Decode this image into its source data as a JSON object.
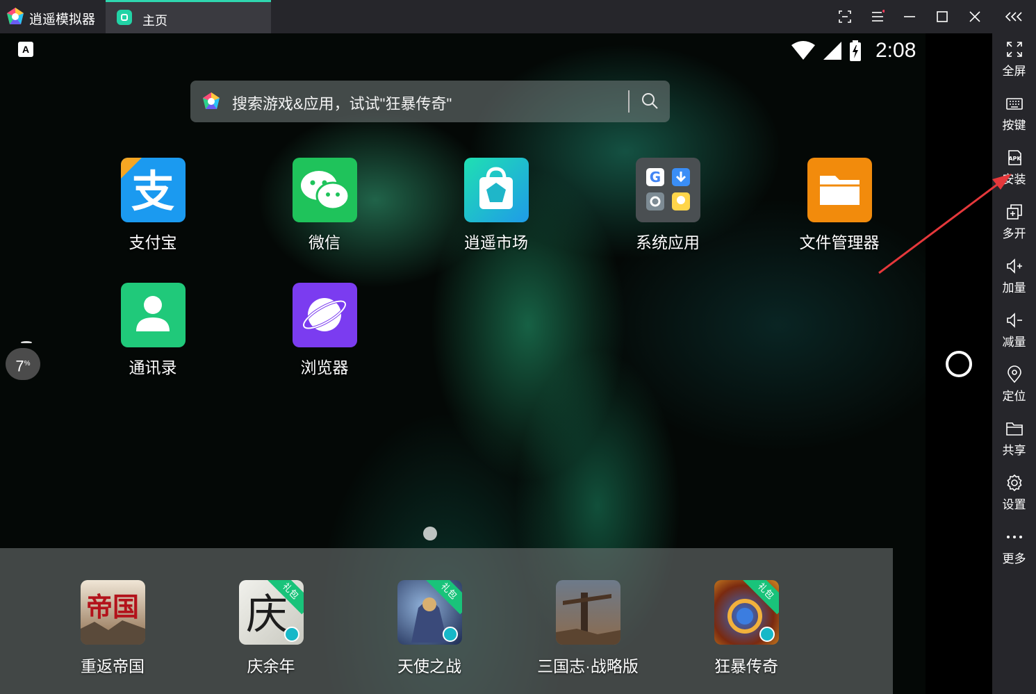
{
  "titlebar": {
    "app_name": "逍遥模拟器",
    "tab_label": "主页",
    "buttons": [
      "screenshot-icon",
      "menu-icon",
      "minimize-icon",
      "maximize-icon",
      "close-icon"
    ]
  },
  "status": {
    "keyboard_indicator": "A",
    "time": "2:08"
  },
  "search": {
    "placeholder": "搜索游戏&应用，试试\"狂暴传奇\""
  },
  "apps": [
    {
      "label": "支付宝",
      "icon": "alipay-icon"
    },
    {
      "label": "微信",
      "icon": "wechat-icon"
    },
    {
      "label": "逍遥市场",
      "icon": "market-icon"
    },
    {
      "label": "系统应用",
      "icon": "system-apps-folder-icon"
    },
    {
      "label": "文件管理器",
      "icon": "file-manager-icon"
    },
    {
      "label": "通讯录",
      "icon": "contacts-icon"
    },
    {
      "label": "浏览器",
      "icon": "browser-icon"
    }
  ],
  "dock": [
    {
      "label": "重返帝国",
      "icon": "game-chongfan-diguo-icon",
      "icon_text": "帝国"
    },
    {
      "label": "庆余年",
      "icon": "game-qingyunian-icon",
      "icon_text": "庆",
      "badge": "礼包"
    },
    {
      "label": "天使之战",
      "icon": "game-tianshi-zhizhan-icon",
      "badge": "礼包"
    },
    {
      "label": "三国志·战略版",
      "icon": "game-sanguozhi-icon"
    },
    {
      "label": "狂暴传奇",
      "icon": "game-kuangbao-chuanqi-icon",
      "badge": "礼包"
    }
  ],
  "floating_ball": {
    "value": "7",
    "unit": "%"
  },
  "sidebar": {
    "items": [
      {
        "label": "全屏",
        "icon": "fullscreen-icon"
      },
      {
        "label": "按键",
        "icon": "keyboard-icon"
      },
      {
        "label": "安装",
        "icon": "apk-install-icon"
      },
      {
        "label": "多开",
        "icon": "multi-instance-icon"
      },
      {
        "label": "加量",
        "icon": "volume-up-icon"
      },
      {
        "label": "减量",
        "icon": "volume-down-icon"
      },
      {
        "label": "定位",
        "icon": "location-icon"
      },
      {
        "label": "共享",
        "icon": "shared-folder-icon"
      },
      {
        "label": "设置",
        "icon": "settings-icon"
      },
      {
        "label": "更多",
        "icon": "more-icon"
      }
    ]
  },
  "colors": {
    "titlebar": "#26262b",
    "tab_active": "#3a3a40",
    "accent": "#2fd7b0",
    "annotation_arrow": "#e5383b"
  }
}
